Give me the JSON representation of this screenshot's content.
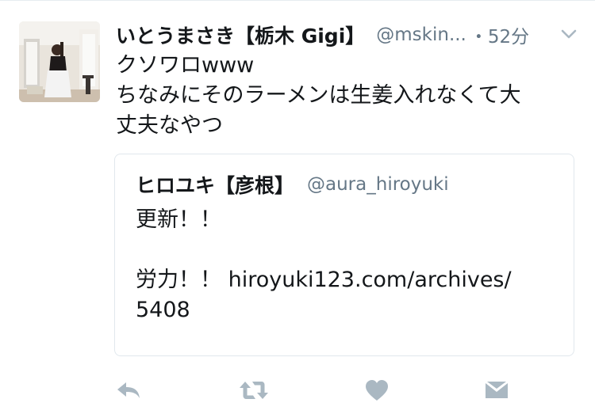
{
  "tweet": {
    "display_name": "いとうまさき【栃木 Gigi】",
    "handle": "@mskin...",
    "time": "・52分",
    "lines": [
      "クソワロwww",
      "ちなみにそのラーメンは生姜入れなくて大",
      "丈夫なやつ"
    ]
  },
  "quote": {
    "display_name": "ヒロユキ【彦根】",
    "handle": "@aura_hiroyuki",
    "lines": [
      "更新！！",
      "",
      "労力！！ hiroyuki123.com/archives/",
      "5408"
    ]
  },
  "actions": {
    "reply_icon": "reply-icon",
    "retweet_icon": "retweet-icon",
    "like_icon": "heart-icon",
    "dm_icon": "envelope-icon"
  },
  "colors": {
    "secondary_text": "#657786",
    "icon": "#aab8c2",
    "border": "#e1e8ed"
  }
}
